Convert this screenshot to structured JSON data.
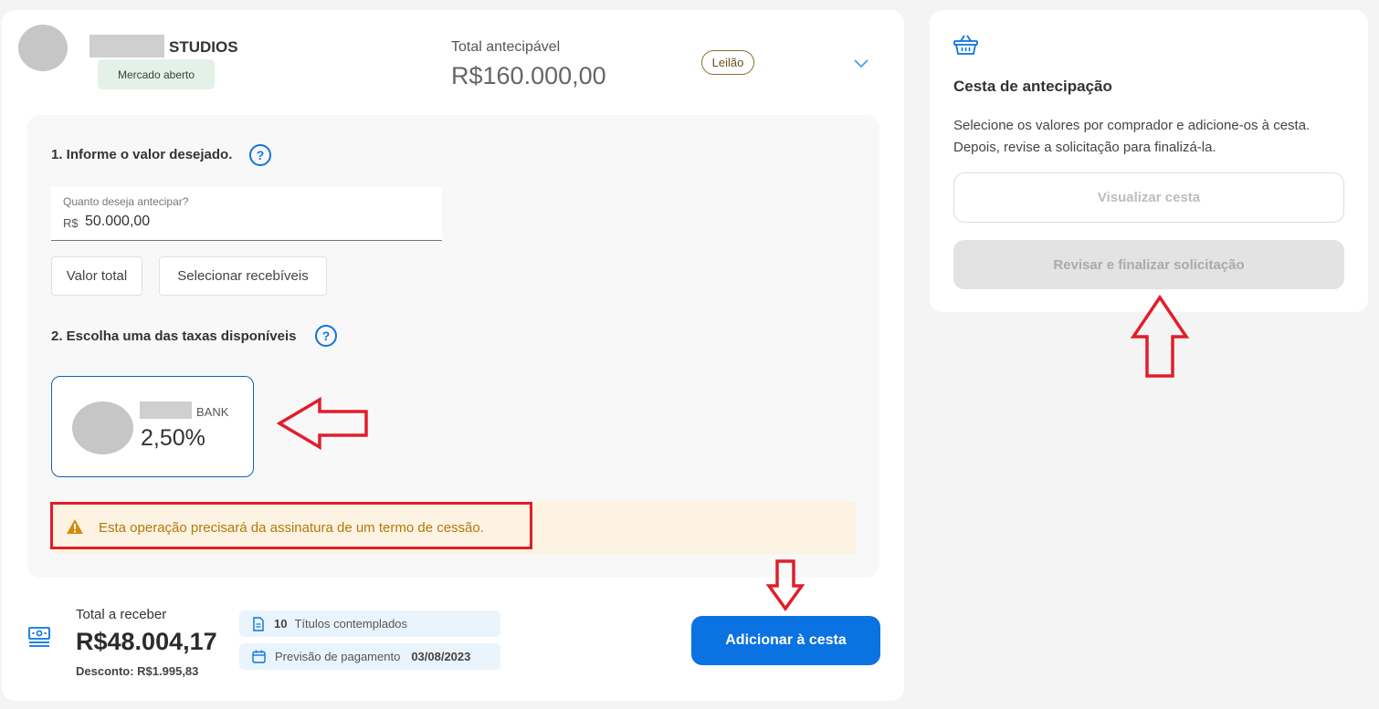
{
  "company": {
    "name_suffix": "STUDIOS",
    "market_badge": "Mercado aberto"
  },
  "summary": {
    "total_label": "Total antecipável",
    "total_value": "R$160.000,00",
    "auction_badge": "Leilão"
  },
  "step1": {
    "title": "1. Informe o valor desejado.",
    "help_symbol": "?",
    "input_label": "Quanto deseja antecipar?",
    "currency_prefix": "R$",
    "input_value": "50.000,00",
    "option_total": "Valor total",
    "option_select": "Selecionar recebíveis"
  },
  "step2": {
    "title": "2. Escolha uma das taxas disponíveis",
    "help_symbol": "?",
    "bank_suffix": "BANK",
    "rate": "2,50%"
  },
  "warning": {
    "text": "Esta operação precisará da assinatura de um termo de cessão."
  },
  "footer": {
    "receive_label": "Total a receber",
    "receive_value": "R$48.004,17",
    "discount": "Desconto: R$1.995,83",
    "titles_count": "10",
    "titles_label": "Títulos contemplados",
    "payment_label": "Previsão de pagamento",
    "payment_date": "03/08/2023",
    "add_button": "Adicionar à cesta"
  },
  "basket": {
    "title": "Cesta de antecipação",
    "desc_line1": "Selecione os valores por comprador e adicione-os à cesta.",
    "desc_line2": "Depois, revise a solicitação para finalizá-la.",
    "view_button": "Visualizar cesta",
    "finalize_button": "Revisar e finalizar solicitação"
  },
  "colors": {
    "primary": "#0a72e1",
    "annotation_red": "#e11d2a",
    "warning_text": "#b57708",
    "warning_bg": "#fdf3e3",
    "market_badge_bg": "#e4f1e8"
  }
}
